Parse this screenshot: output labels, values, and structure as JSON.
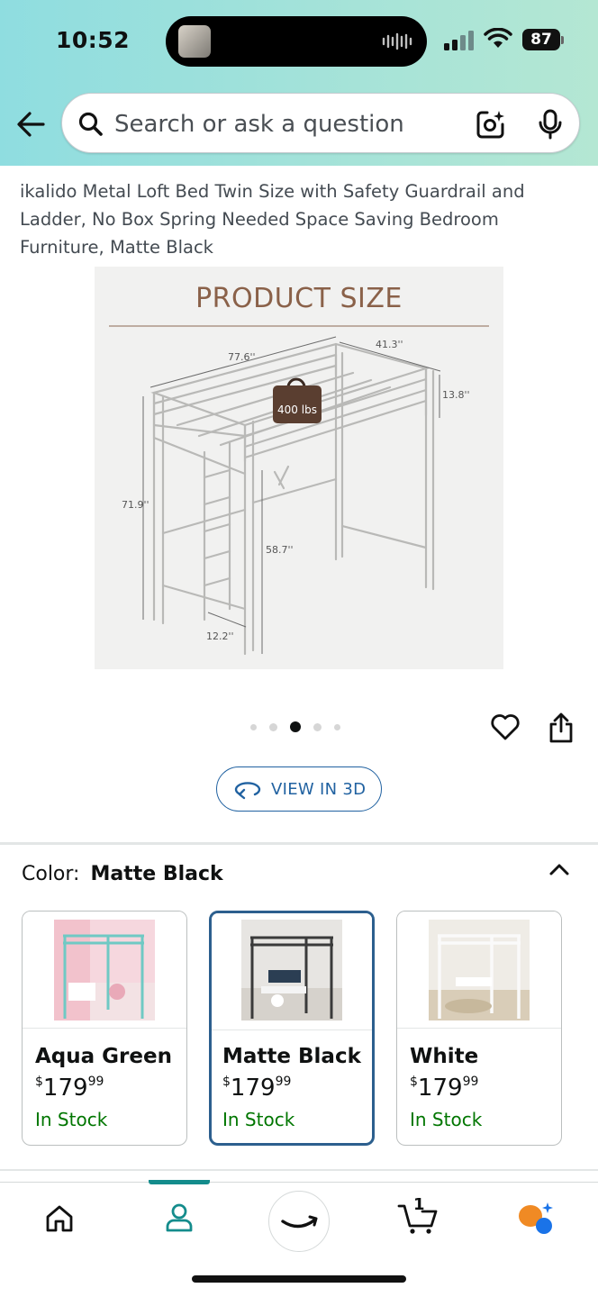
{
  "status_bar": {
    "time": "10:52",
    "battery": "87"
  },
  "search": {
    "placeholder": "Search or ask a question"
  },
  "product": {
    "title": "ikalido Metal Loft Bed Twin Size with Safety Guardrail and Ladder, No Box Spring Needed Space Saving Bedroom Furniture, Matte Black",
    "image": {
      "heading": "PRODUCT SIZE",
      "dim_length": "77.6''",
      "dim_width": "41.3''",
      "dim_guardrail": "13.8''",
      "dim_height": "71.9''",
      "dim_clearance": "58.7''",
      "dim_ladder": "12.2''",
      "capacity": "400 lbs"
    },
    "carousel": {
      "total": 5,
      "active_index": 2
    },
    "view_3d_label": "VIEW IN 3D"
  },
  "color_selector": {
    "label": "Color:",
    "selected": "Matte Black",
    "options": [
      {
        "name": "Aqua Green",
        "currency": "$",
        "dollars": "179",
        "cents": "99",
        "stock": "In Stock",
        "selected": false
      },
      {
        "name": "Matte Black",
        "currency": "$",
        "dollars": "179",
        "cents": "99",
        "stock": "In Stock",
        "selected": true
      },
      {
        "name": "White",
        "currency": "$",
        "dollars": "179",
        "cents": "99",
        "stock": "In Stock",
        "selected": false
      }
    ]
  },
  "bottom_nav": {
    "items": [
      "home-icon",
      "account-icon",
      "amazon-smile-icon",
      "cart-icon",
      "rufus-icon"
    ],
    "active": "account-icon",
    "cart_count": "1"
  },
  "colors": {
    "accent": "#2162a1",
    "stock": "#007600",
    "nav_indicator": "#148c8c",
    "heading_brown": "#8a6149"
  }
}
